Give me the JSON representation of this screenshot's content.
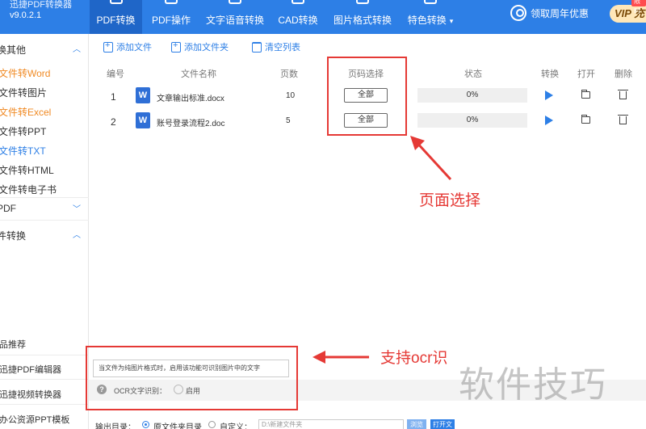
{
  "app": {
    "name": "迅捷PDF转换器",
    "version": "v9.0.2.1"
  },
  "nav": {
    "tabs": [
      {
        "label": "PDF转换",
        "icon": "pdf-convert-icon"
      },
      {
        "label": "PDF操作",
        "icon": "pdf-operate-icon"
      },
      {
        "label": "文字语音转换",
        "icon": "text-speech-icon"
      },
      {
        "label": "CAD转换",
        "icon": "cad-icon"
      },
      {
        "label": "图片格式转换",
        "icon": "image-format-icon"
      },
      {
        "label": "特色转换",
        "icon": "special-icon",
        "arrow": "▾"
      }
    ],
    "promo": "领取周年优惠",
    "vip": "VIP 充",
    "vip_badge": "限时"
  },
  "sidebar": {
    "group1": "换其他",
    "items": [
      {
        "label": "文件转Word",
        "color": "orange"
      },
      {
        "label": "文件转图片",
        "color": "dark"
      },
      {
        "label": "文件转Excel",
        "color": "orange"
      },
      {
        "label": "文件转PPT",
        "color": "dark"
      },
      {
        "label": "文件转TXT",
        "color": "blue"
      },
      {
        "label": "文件转HTML",
        "color": "dark"
      },
      {
        "label": "文件转电子书",
        "color": "dark"
      }
    ],
    "group2": "PDF",
    "group3": "件转换",
    "recommend_title": "品推荐",
    "recommend": [
      "迅捷PDF编辑器",
      "迅捷视频转换器",
      "办公资源PPT模板"
    ]
  },
  "toolbar": {
    "add_file": "添加文件",
    "add_folder": "添加文件夹",
    "clear_list": "清空列表"
  },
  "table": {
    "headers": [
      "编号",
      "文件名称",
      "页数",
      "页码选择",
      "状态",
      "转换",
      "打开",
      "删除"
    ],
    "rows": [
      {
        "num": "1",
        "icon": "W",
        "name": "文章输出标准.docx",
        "pages": "10",
        "page_select": "全部",
        "progress": "0%"
      },
      {
        "num": "2",
        "icon": "W",
        "name": "账号登录流程2.doc",
        "pages": "5",
        "page_select": "全部",
        "progress": "0%"
      }
    ]
  },
  "annotations": {
    "page_select": "页面选择",
    "ocr_support": "支持ocr识"
  },
  "ocr": {
    "description": "当文件为纯图片格式时，启用该功能可识别图片中的文字",
    "label": "OCR文字识别：",
    "enable": "启用"
  },
  "output": {
    "label": "输出目录：",
    "option_original": "原文件夹目录",
    "option_custom": "自定义：",
    "path": "D:\\新建文件夹",
    "browse": "浏览",
    "open_folder": "打开文"
  },
  "watermark": "软件技巧",
  "colors": {
    "primary": "#2d7fe6",
    "annotation": "#e53935",
    "orange": "#f08a24"
  }
}
